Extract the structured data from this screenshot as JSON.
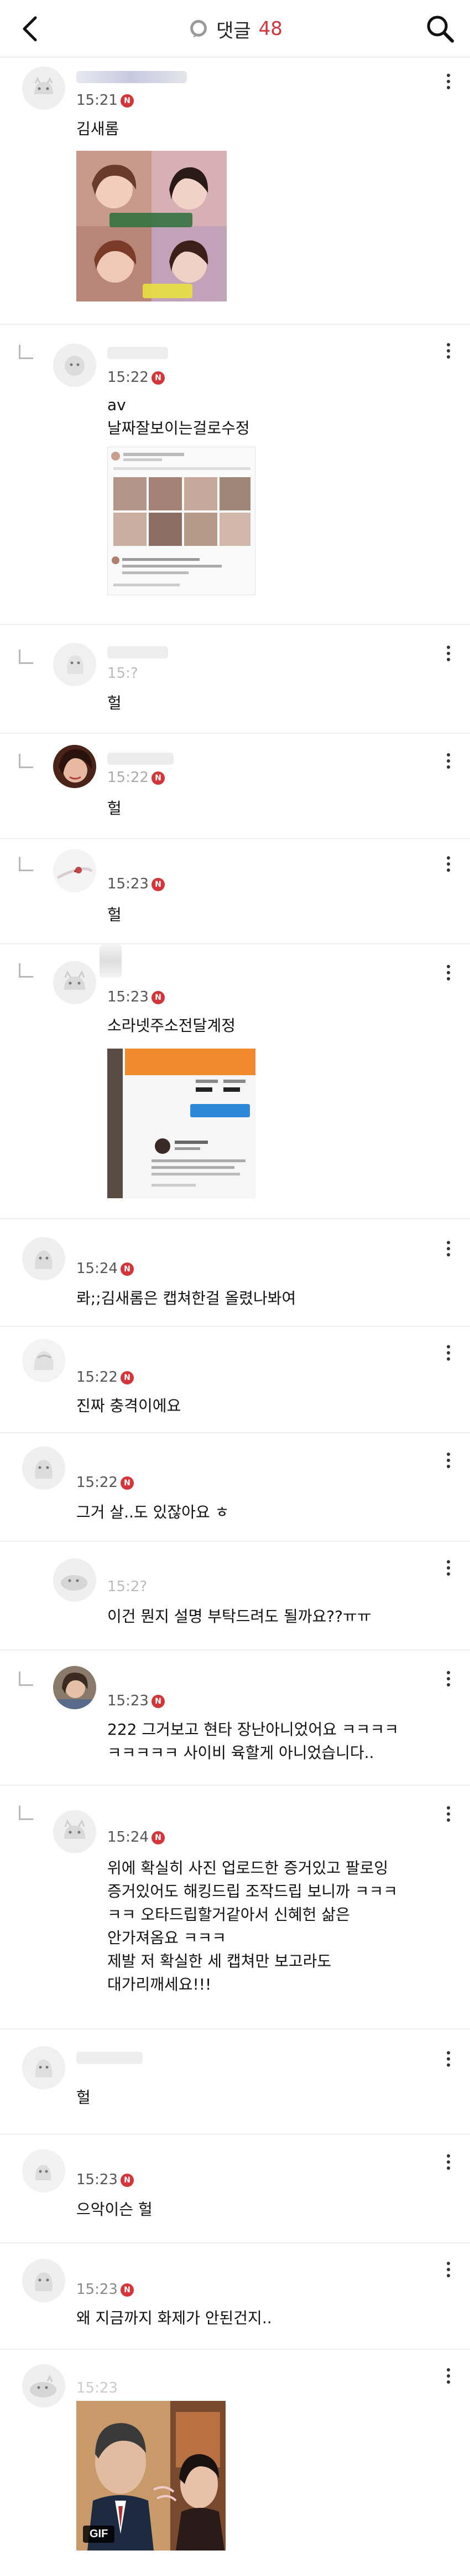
{
  "header": {
    "back_icon": "chevron-left-icon",
    "title": "댓글",
    "count": "48",
    "search_icon": "search-icon",
    "accent_color": "#d2353a"
  },
  "comments": [
    {
      "nick": "",
      "time": "15:21",
      "text": "김새롬",
      "media": "photo-collage"
    },
    {
      "nick": "",
      "time": "15:22",
      "text": "av\n날짜잘보이는걸로수정",
      "media": "screenshot"
    },
    {
      "nick": "",
      "time": "15:?",
      "text": "헐"
    },
    {
      "nick": "",
      "time": "15:22",
      "text": "헐"
    },
    {
      "nick": "",
      "time": "15:23",
      "text": "헐"
    },
    {
      "nick": "",
      "time": "15:23",
      "text": "소라넷주소전달계정",
      "media": "profile-screenshot"
    },
    {
      "nick": "",
      "time": "15:24",
      "text": "롸;;김새롬은 캡쳐한걸 올렸나봐여"
    },
    {
      "nick": "",
      "time": "15:22",
      "text": "진짜 충격이에요"
    },
    {
      "nick": "",
      "time": "15:22",
      "text": "그거 살..도 있잖아요 ㅎ"
    },
    {
      "nick": "",
      "time": "15:2?",
      "text": "이건 뭔지 설명 부탁드려도 될까요??ㅠㅠ"
    },
    {
      "nick": "",
      "time": "15:23",
      "text": "222 그거보고 현타 장난아니었어요 ㅋㅋㅋㅋ\nㅋㅋㅋㅋㅋ 사이비 육할게 아니었습니다.."
    },
    {
      "nick": "",
      "time": "15:24",
      "text": "위에 확실히 사진 업로드한 증거있고 팔로잉\n증거있어도 해킹드립 조작드립 보니까 ㅋㅋㅋ\nㅋㅋ 오타드립할거같아서 신혜헌 삶은\n안가져옴요 ㅋㅋㅋ\n제발 저 확실한 세 캡쳐만 보고라도\n대가리깨세요!!!"
    },
    {
      "nick": "",
      "time": "",
      "text": "헐"
    },
    {
      "nick": "",
      "time": "15:23",
      "text": "으악이슨 헐"
    },
    {
      "nick": "",
      "time": "15:23",
      "text": "왜 지금까지 화제가 안된건지.."
    },
    {
      "nick": "",
      "time": "15:23",
      "text": "",
      "media": "gif",
      "gif_label": "GIF"
    }
  ],
  "icons": {
    "more": "more-vertical-icon",
    "new_badge": "N"
  }
}
